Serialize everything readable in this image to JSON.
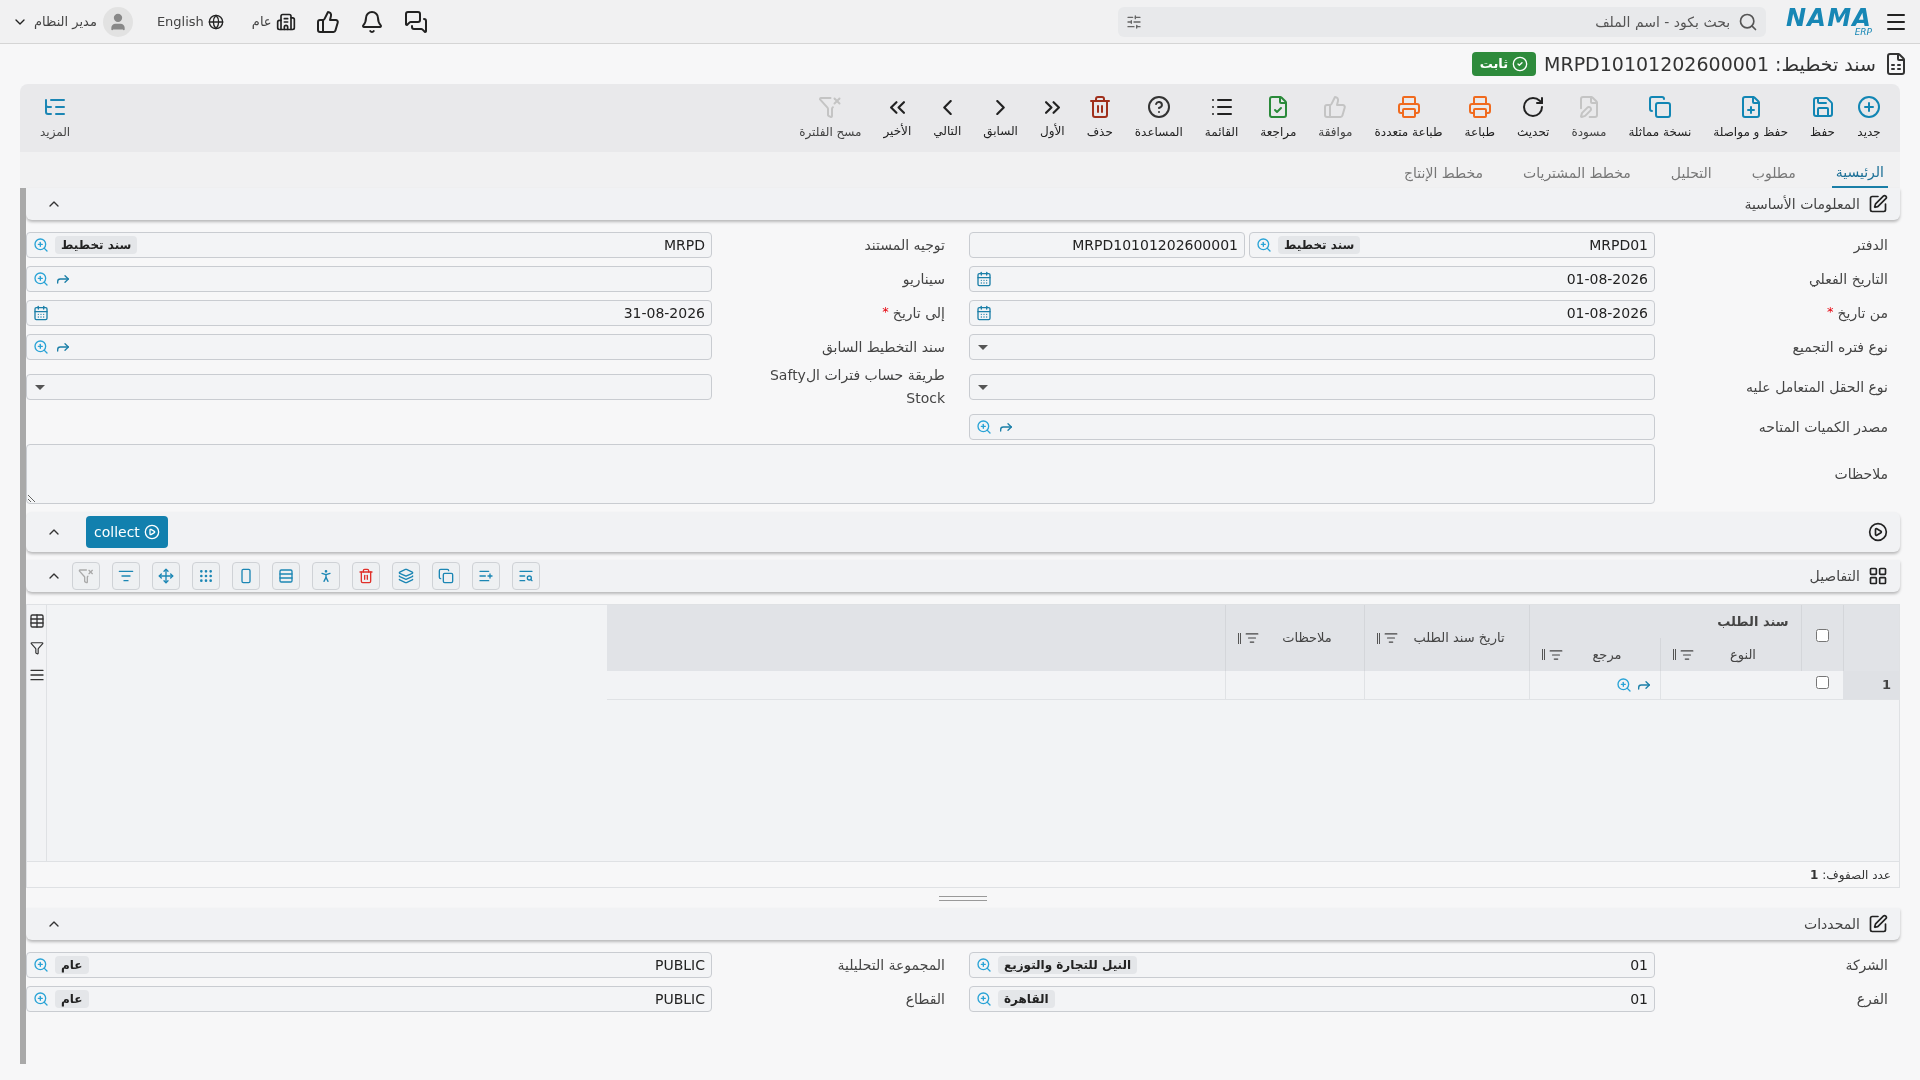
{
  "topbar": {
    "logo": "NAMA",
    "logo_sub": "ERP",
    "search": {
      "placeholder": "بحث بكود - اسم الملف"
    },
    "company": "عام",
    "language": "English",
    "user": "مدير النظام"
  },
  "document": {
    "title": "سند تخطيط: MRPD10101202600001",
    "status": "ثابت"
  },
  "toolbar": [
    {
      "label": "جديد",
      "disabled": false
    },
    {
      "label": "حفظ",
      "disabled": false
    },
    {
      "label": "حفظ و مواصلة",
      "disabled": false
    },
    {
      "label": "نسخة مماثلة",
      "disabled": false
    },
    {
      "label": "مسودة",
      "disabled": true
    },
    {
      "label": "تحديث",
      "disabled": false
    },
    {
      "label": "طباعة",
      "disabled": false
    },
    {
      "label": "طباعة متعددة",
      "disabled": false
    },
    {
      "label": "موافقة",
      "disabled": true
    },
    {
      "label": "مراجعة",
      "disabled": false
    },
    {
      "label": "القائمة",
      "disabled": false
    },
    {
      "label": "المساعدة",
      "disabled": false
    },
    {
      "label": "حذف",
      "disabled": false
    },
    {
      "label": "الأول",
      "disabled": false
    },
    {
      "label": "السابق",
      "disabled": false
    },
    {
      "label": "التالي",
      "disabled": false
    },
    {
      "label": "الأخير",
      "disabled": false
    },
    {
      "label": "مسح الفلترة",
      "disabled": true
    }
  ],
  "more": "المزيد",
  "tabs": [
    {
      "label": "الرئيسية",
      "selected": true
    },
    {
      "label": "مطلوب",
      "selected": false
    },
    {
      "label": "التحليل",
      "selected": false
    },
    {
      "label": "مخطط المشتريات",
      "selected": false
    },
    {
      "label": "مخطط الإنتاج",
      "selected": false
    }
  ],
  "basic_info": {
    "title": "المعلومات الأساسية",
    "rows": [
      [
        {
          "kind": "ledger",
          "label": "الدفتر",
          "value": "MRPD01",
          "tag": "سند تخطيط",
          "second_value": "MRPD10101202600001"
        },
        {
          "kind": "lookup",
          "label": "توجيه المستند",
          "value": "MRPD",
          "tag": "سند تخطيط",
          "link": false
        }
      ],
      [
        {
          "kind": "date",
          "label": "التاريخ الفعلي",
          "value": "01-08-2026"
        },
        {
          "kind": "lookup",
          "label": "سيناريو",
          "link": true
        }
      ],
      [
        {
          "kind": "date",
          "label": "من تاريخ",
          "required_mark": "*",
          "value": "01-08-2026"
        },
        {
          "kind": "date",
          "label": "إلى تاريخ",
          "required_mark": "*",
          "value": "31-08-2026"
        }
      ],
      [
        {
          "kind": "select",
          "label": "نوع فتره التجميع"
        },
        {
          "kind": "lookup",
          "label": "سند التخطيط السابق",
          "link": true
        }
      ],
      [
        {
          "kind": "select",
          "label": "نوع الحقل المتعامل عليه"
        },
        {
          "kind": "select",
          "label": "طريقة حساب فترات الSafty Stock"
        }
      ],
      [
        {
          "kind": "lookup",
          "label": "مصدر الكميات المتاحه",
          "link": true
        }
      ]
    ],
    "notes_label": "ملاحظات"
  },
  "collect_button": "collect",
  "details": {
    "title": "التفاصيل",
    "group_header": "سند الطلب",
    "columns": [
      "النوع",
      "مرجع",
      "تاريخ سند الطلب",
      "ملاحظات"
    ],
    "select_all_checked": false,
    "rows": [
      {
        "number": "1",
        "checked": false
      }
    ],
    "row_count": "عدد الصفوف: **1**"
  },
  "dimensions": {
    "title": "المحددات",
    "rows": [
      [
        {
          "kind": "lookup",
          "label": "الشركة",
          "value": "01",
          "tag": "النيل للتجارة والتوزيع",
          "link": false
        },
        {
          "kind": "lookup",
          "label": "المجموعة التحليلية",
          "value": "PUBLIC",
          "tag": "عام",
          "link": false
        }
      ],
      [
        {
          "kind": "lookup",
          "label": "الفرع",
          "value": "01",
          "tag": "القاهرة",
          "link": false
        },
        {
          "kind": "lookup",
          "label": "القطاع",
          "value": "PUBLIC",
          "tag": "عام",
          "link": false
        }
      ]
    ]
  }
}
